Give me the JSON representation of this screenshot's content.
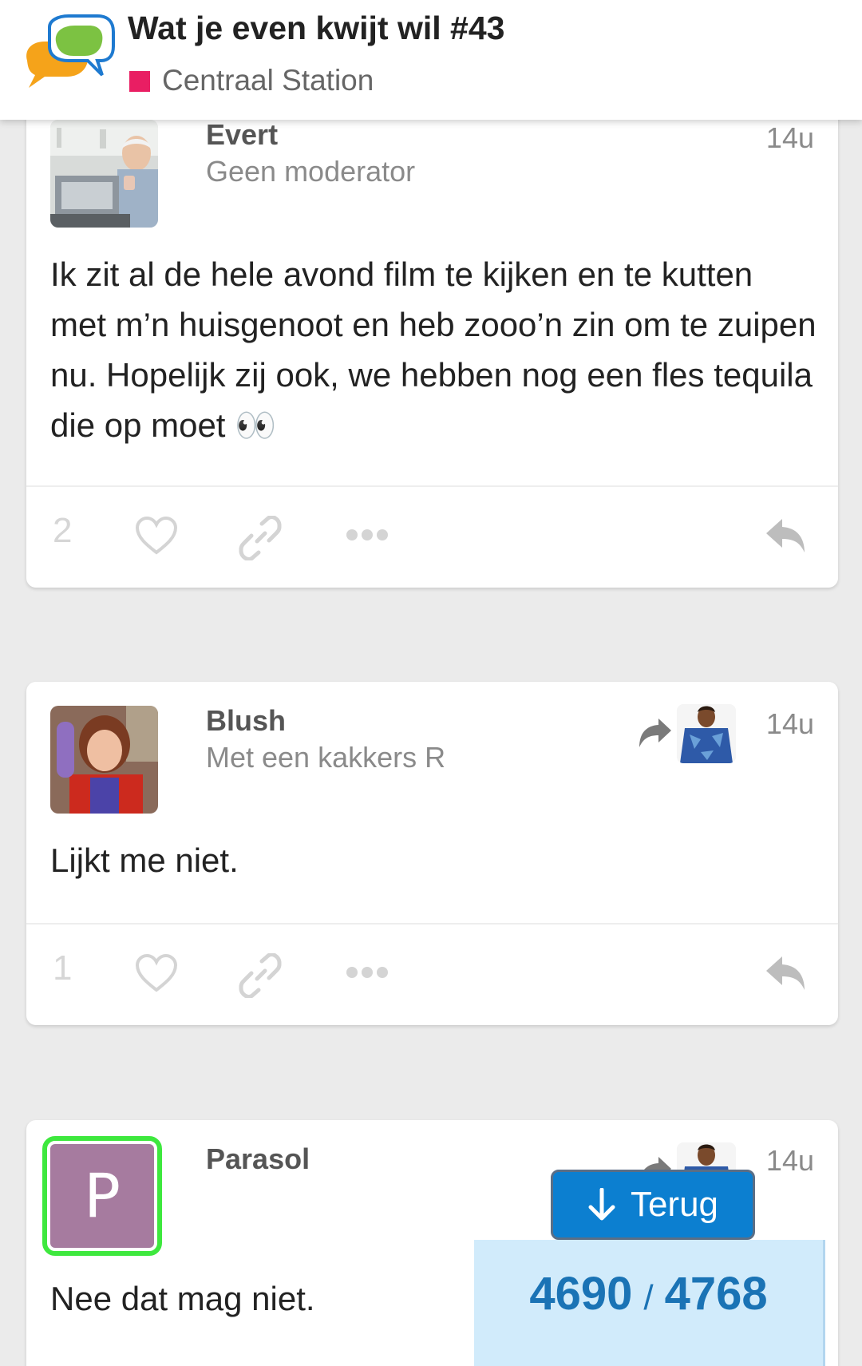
{
  "header": {
    "title": "Wat je even kwijt wil #43",
    "category": "Centraal Station",
    "category_color": "#e91e63"
  },
  "posts": [
    {
      "username": "Evert",
      "user_title": "Geen moderator",
      "time": "14u",
      "body": "Ik zit al de hele avond film te kijken en te kutten met m’n huisgenoot en heb zooo’n zin om te zuipen nu. Hopelijk zij ook, we hebben nog een fles tequila die op moet 👀",
      "like_count": "2"
    },
    {
      "username": "Blush",
      "user_title": "Met een kakkers R",
      "time": "14u",
      "body": "Lijkt me niet.",
      "like_count": "1"
    },
    {
      "username": "Parasol",
      "avatar_letter": "P",
      "time": "14u",
      "body": "Nee dat mag niet."
    }
  ],
  "icons": [
    "heart-icon",
    "link-icon",
    "more-icon",
    "reply-icon",
    "reply-to-arrow-icon",
    "arrow-down-icon"
  ],
  "back_button": {
    "label": "Terug"
  },
  "progress": {
    "current": "4690",
    "separator": "/",
    "total": "4768"
  },
  "colors": {
    "accent": "#0c7fd0",
    "progress_bg": "#d1ebfb",
    "progress_text": "#1a73b5",
    "avatar_ring": "#3ee83e",
    "letter_avatar_bg": "#a67b9f"
  }
}
